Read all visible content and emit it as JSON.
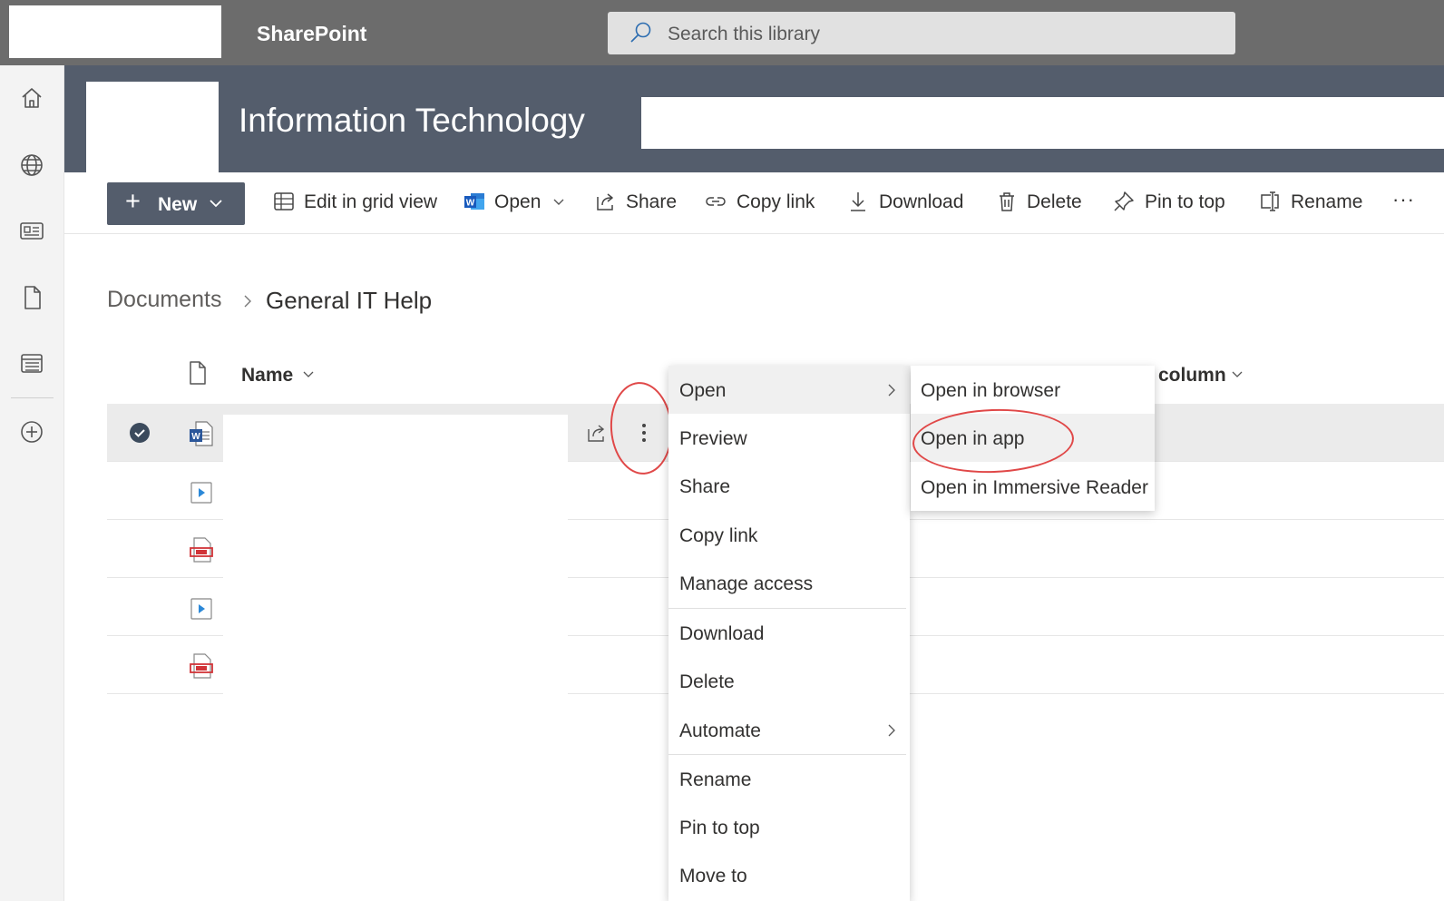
{
  "suite_bar": {
    "app_name": "SharePoint",
    "search_placeholder": "Search this library"
  },
  "left_nav": {
    "icons": [
      "home-icon",
      "globe-icon",
      "news-icon",
      "file-icon",
      "list-icon",
      "add-circle-icon"
    ]
  },
  "site_header": {
    "title": "Information Technology"
  },
  "command_bar": {
    "new_label": "New",
    "edit_grid_label": "Edit in grid view",
    "open_label": "Open",
    "share_label": "Share",
    "copy_link_label": "Copy link",
    "download_label": "Download",
    "delete_label": "Delete",
    "pin_label": "Pin to top",
    "rename_label": "Rename",
    "more_label": "···"
  },
  "breadcrumb": {
    "parent": "Documents",
    "current": "General IT Help"
  },
  "list": {
    "columns": {
      "name": "Name",
      "custom": "column"
    },
    "rows": [
      {
        "type": "word",
        "selected": true
      },
      {
        "type": "video",
        "selected": false
      },
      {
        "type": "pdf",
        "selected": false
      },
      {
        "type": "video",
        "selected": false
      },
      {
        "type": "pdf",
        "selected": false
      }
    ]
  },
  "context_menu": {
    "items": [
      {
        "label": "Open",
        "has_submenu": true
      },
      {
        "label": "Preview"
      },
      {
        "label": "Share"
      },
      {
        "label": "Copy link"
      },
      {
        "label": "Manage access"
      },
      {
        "label": "Download"
      },
      {
        "label": "Delete"
      },
      {
        "label": "Automate",
        "has_submenu": true
      },
      {
        "label": "Rename"
      },
      {
        "label": "Pin to top"
      },
      {
        "label": "Move to"
      }
    ]
  },
  "submenu": {
    "items": [
      {
        "label": "Open in browser"
      },
      {
        "label": "Open in app"
      },
      {
        "label": "Open in Immersive Reader"
      }
    ]
  },
  "colors": {
    "suite_bar": "#6c6c6c",
    "site_header": "#545d6c",
    "annotation": "#e04848",
    "word_blue": "#2b579a",
    "pdf_red": "#d13438"
  }
}
